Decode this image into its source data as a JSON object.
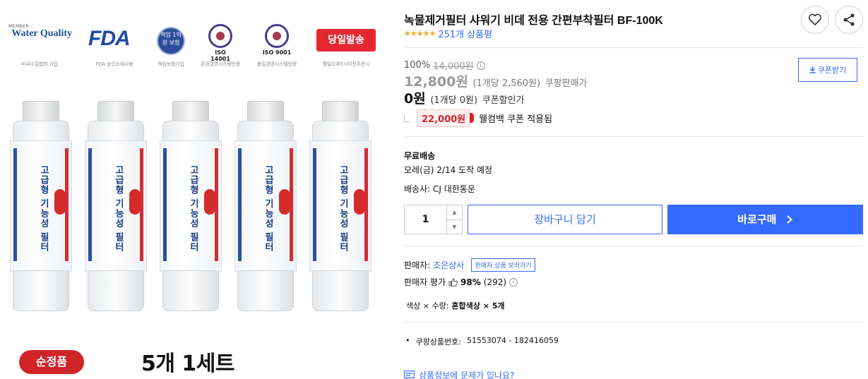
{
  "image": {
    "badges": [
      {
        "member": "MEMBER",
        "text": "Water Quality",
        "caption": "미국수질협회 가입"
      },
      {
        "text": "FDA",
        "caption": "FDA 승인소재사용"
      },
      {
        "text": "책임 1억원 보험",
        "caption": "책임보험가입"
      },
      {
        "text": "ISO 14001",
        "caption": "환경경영시스템인증"
      },
      {
        "text": "ISO 9001",
        "caption": "품질경영시스템인증"
      },
      {
        "text": "당일발송",
        "caption": "평일오후5시이전주문시"
      }
    ],
    "filter_label": "고급형 기능성 필터",
    "genuine_label": "순정품",
    "set_label": "5개 1세트"
  },
  "product": {
    "title": "녹물제거필터 샤워기 비데 전용 간편부착필터 BF-100K",
    "stars": "★★★★★",
    "review_count": "251개 상품평"
  },
  "price": {
    "discount_rate": "100%",
    "original": "14,000원",
    "sale": "12,800원",
    "sale_unit": "(1개당 2,560원)",
    "sale_label": "쿠팡판매가",
    "coupon": "0원",
    "coupon_unit": "(1개당 0원)",
    "coupon_label": "쿠폰할인가",
    "coupon_button": "쿠폰받기",
    "welcome_amount": "22,000원",
    "welcome_text": "웰컴백 쿠폰 적용됨"
  },
  "shipping": {
    "title": "무료배송",
    "arrival": "모레(금) 2/14 도착 예정",
    "carrier": "배송사: CJ 대한통운"
  },
  "purchase": {
    "quantity": "1",
    "cart_label": "장바구니 담기",
    "buy_label": "바로구매"
  },
  "seller": {
    "label": "판매자:",
    "name": "조은상사",
    "view_label": "판매자 상품 보러가기",
    "rating_label": "판매자 평가",
    "rating_value": "98%",
    "rating_count": "(292)"
  },
  "options": {
    "text": "색상 × 수량:",
    "value": "혼합색상 × 5개"
  },
  "product_number": {
    "label": "쿠팡상품번호:",
    "value": "51553074 - 182416059"
  },
  "report_label": "상품정보에 문제가 있나요?",
  "colors": {
    "accent": "#346aff",
    "red": "#d9232d"
  }
}
